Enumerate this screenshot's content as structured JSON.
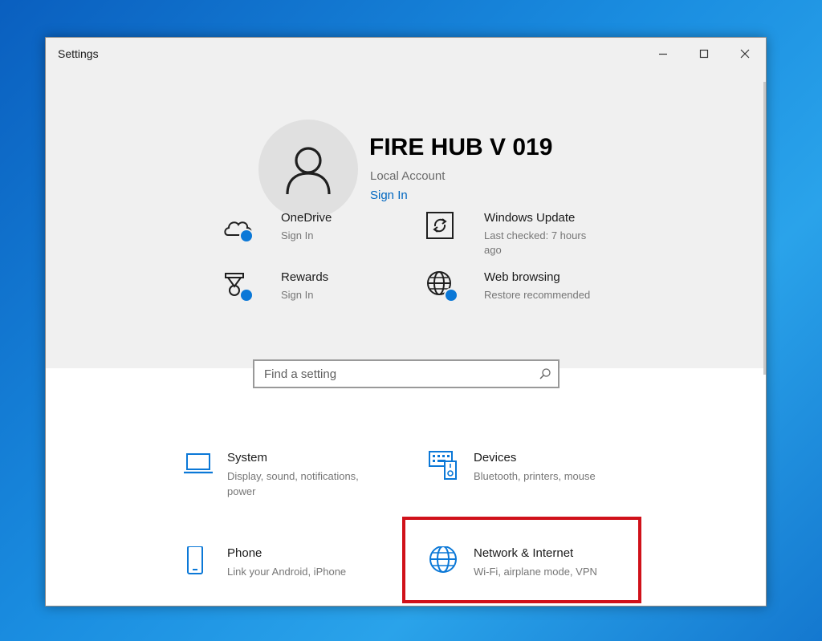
{
  "window": {
    "title": "Settings"
  },
  "account": {
    "name": "FIRE HUB V 019",
    "type": "Local Account",
    "sign_in": "Sign In"
  },
  "quick_tiles": [
    {
      "title": "OneDrive",
      "subtitle": "Sign In"
    },
    {
      "title": "Windows Update",
      "subtitle": "Last checked: 7 hours ago"
    },
    {
      "title": "Rewards",
      "subtitle": "Sign In"
    },
    {
      "title": "Web browsing",
      "subtitle": "Restore recommended"
    }
  ],
  "search": {
    "placeholder": "Find a setting"
  },
  "categories": [
    {
      "title": "System",
      "subtitle": "Display, sound, notifications, power"
    },
    {
      "title": "Devices",
      "subtitle": "Bluetooth, printers, mouse"
    },
    {
      "title": "Phone",
      "subtitle": "Link your Android, iPhone"
    },
    {
      "title": "Network & Internet",
      "subtitle": "Wi-Fi, airplane mode, VPN"
    }
  ],
  "colors": {
    "accent": "#0067c0",
    "icon_blue": "#0b78d7",
    "highlight_red": "#d0111a",
    "hero_bg": "#f0f0f0"
  },
  "icons": [
    "minimize-icon",
    "maximize-icon",
    "close-icon",
    "user-icon",
    "cloud-icon",
    "update-icon",
    "rewards-icon",
    "globe-icon",
    "search-icon",
    "laptop-icon",
    "keyboard-icon",
    "phone-icon",
    "network-globe-icon"
  ]
}
